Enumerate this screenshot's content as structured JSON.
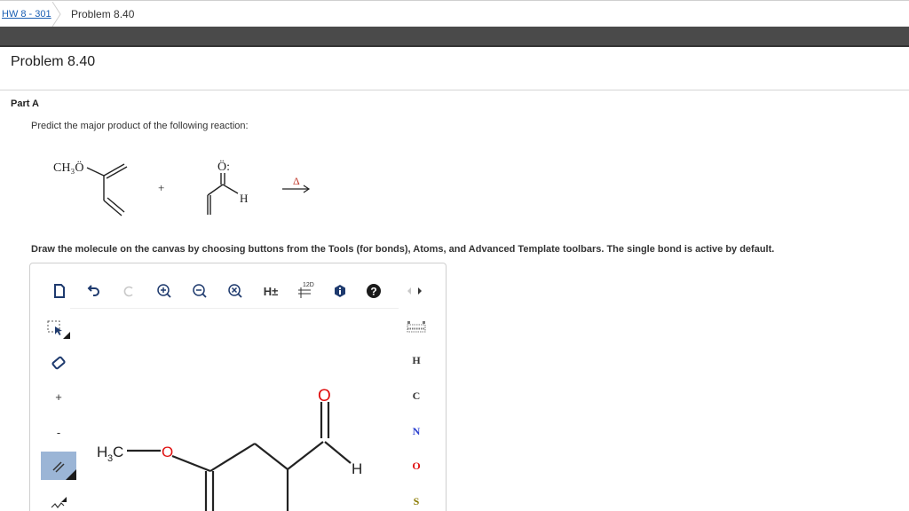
{
  "breadcrumb": {
    "parent": "HW 8 - 301",
    "current": "Problem 8.40"
  },
  "problem": {
    "title": "Problem 8.40"
  },
  "part": {
    "label": "Part A",
    "question": "Predict the major product of the following reaction:"
  },
  "reaction": {
    "methoxy": "CH₃Ö",
    "carbonyl_o": "Ö:",
    "aldehyde_h": "H",
    "plus": "+",
    "heat": "Δ"
  },
  "instructions": "Draw the molecule on the canvas by choosing buttons from the Tools (for bonds), Atoms, and Advanced Template toolbars. The single bond is active by default.",
  "toolbar": {
    "h_toggle": "H±",
    "twod": "12D",
    "icons": [
      "new-document-icon",
      "undo-icon",
      "redo-icon",
      "zoom-in-icon",
      "zoom-out-icon",
      "clear-icon",
      "h-toggle-icon",
      "2d-clean-icon",
      "info-icon",
      "help-icon",
      "scroll-arrows-icon"
    ]
  },
  "left_tools": {
    "plus": "+",
    "minus": "-",
    "icons": [
      "select-icon",
      "eraser-icon",
      "positive-charge-icon",
      "negative-charge-icon",
      "double-bond-icon",
      "chain-icon"
    ],
    "active": "double-bond-icon"
  },
  "atoms": [
    {
      "symbol": "H",
      "color": "#333333"
    },
    {
      "symbol": "C",
      "color": "#333333"
    },
    {
      "symbol": "N",
      "color": "#2a3fcf"
    },
    {
      "symbol": "O",
      "color": "#e01010"
    },
    {
      "symbol": "S",
      "color": "#8a7a00"
    }
  ],
  "canvas": {
    "methyl": "H",
    "methyl_sub": "3",
    "methyl_c": "C",
    "ether_o": "O",
    "carbonyl_o": "O",
    "aldehyde_h": "H"
  }
}
